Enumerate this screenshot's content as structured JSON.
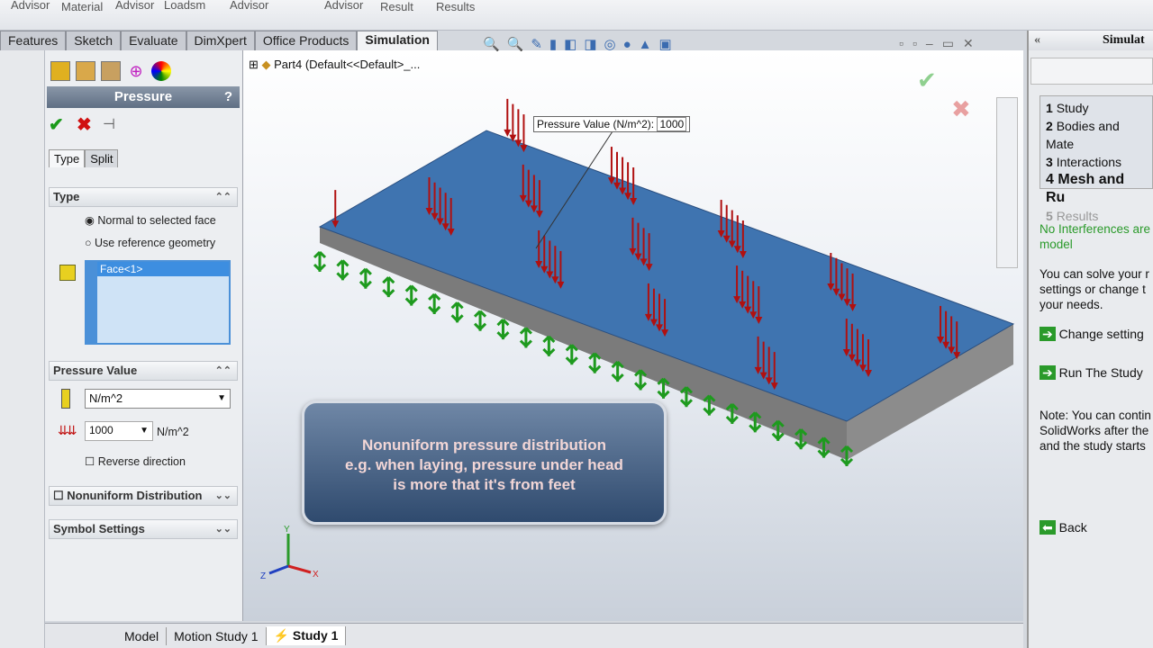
{
  "ribbon": {
    "items": [
      "Advisor",
      "Material",
      "Advisor",
      "Loadsm",
      "Advisor",
      "Advisor",
      "Result",
      "Results"
    ]
  },
  "tabs": [
    "Features",
    "Sketch",
    "Evaluate",
    "DimXpert",
    "Office Products",
    "Simulation"
  ],
  "tree": {
    "root": "Part4  (Default<<Default>_..."
  },
  "pm": {
    "title": "Pressure",
    "help": "?",
    "subtabs": [
      "Type",
      "Split"
    ],
    "type_section": "Type",
    "option1": "Normal to selected face",
    "option2": "Use reference geometry",
    "face": "Face<1>",
    "pv_section": "Pressure Value",
    "unit": "N/m^2",
    "value": "1000",
    "value_unit": "N/m^2",
    "reverse": "Reverse direction",
    "nonuniform": "Nonuniform Distribution",
    "symbol": "Symbol Settings"
  },
  "callout": {
    "label": "Pressure Value (N/m^2):",
    "value": "1000"
  },
  "caption": {
    "line1": "Nonuniform pressure distribution",
    "line2": "e.g. when laying, pressure under head",
    "line3": "is more that it's from feet"
  },
  "taskpane": {
    "title": "Simulat",
    "steps": [
      {
        "n": "1",
        "label": "Study"
      },
      {
        "n": "2",
        "label": "Bodies and Mate"
      },
      {
        "n": "3",
        "label": "Interactions"
      },
      {
        "n": "4",
        "label": "Mesh and Ru"
      },
      {
        "n": "5",
        "label": "Results"
      }
    ],
    "interf": "No Interferences are",
    "interf2": "model",
    "solve1": "You can solve your r",
    "solve2": "settings or change t",
    "solve3": "your needs.",
    "change": "Change setting",
    "run": "Run The Study",
    "note1": "Note: You can contin",
    "note2": "SolidWorks after the",
    "note3": "and the study starts",
    "back": "Back"
  },
  "bottom_tabs": [
    "Model",
    "Motion Study 1",
    "Study 1"
  ],
  "axes": {
    "y": "Y",
    "z": "Z",
    "x": "X"
  },
  "colors": {
    "face": "#3f74b0",
    "arrows": "#b01010",
    "fixtures": "#1e9a1e"
  }
}
